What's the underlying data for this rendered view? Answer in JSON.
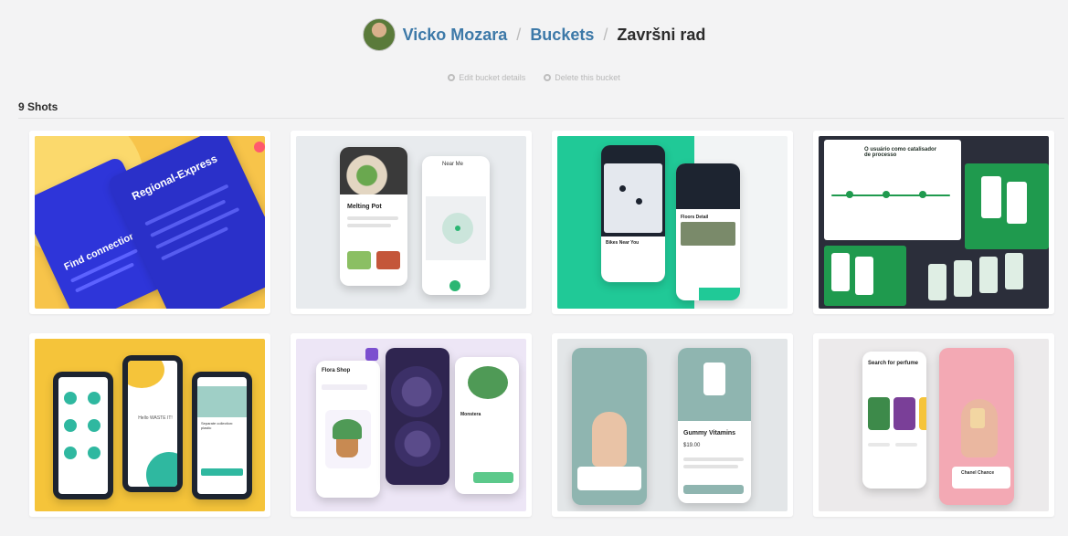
{
  "breadcrumb": {
    "user": "Vicko Mozara",
    "section": "Buckets",
    "current": "Završni rad",
    "separator": "/"
  },
  "actions": {
    "edit": "Edit bucket details",
    "delete": "Delete this bucket"
  },
  "shots_count": "9 Shots",
  "shots": [
    {
      "title": "Regional-Express",
      "label": "Find connection",
      "accent": "#2e35d9"
    },
    {
      "title": "Melting Pot",
      "label": "Near Me",
      "accent": "#2bb673"
    },
    {
      "title": "Bikes Near You",
      "label": "Floors Detail",
      "accent": "#20c997"
    },
    {
      "title": "O usuário como catalisador de processo",
      "label": "",
      "accent": "#1f9a4e"
    },
    {
      "title": "Hello WASTE IT!",
      "label": "Separate collection: plastic",
      "accent": "#f5c43a"
    },
    {
      "title": "Flora Shop",
      "label": "Monstera",
      "accent": "#7b4fcf"
    },
    {
      "title": "Gummy Vitamins",
      "label": "$19.00",
      "accent": "#8fb5b0"
    },
    {
      "title": "Search for perfume",
      "label": "Chanel Chance",
      "accent": "#f3a9b4"
    }
  ],
  "colors": {
    "link": "#3d79a8",
    "muted": "#b8b8b8",
    "background": "#f3f3f4"
  }
}
